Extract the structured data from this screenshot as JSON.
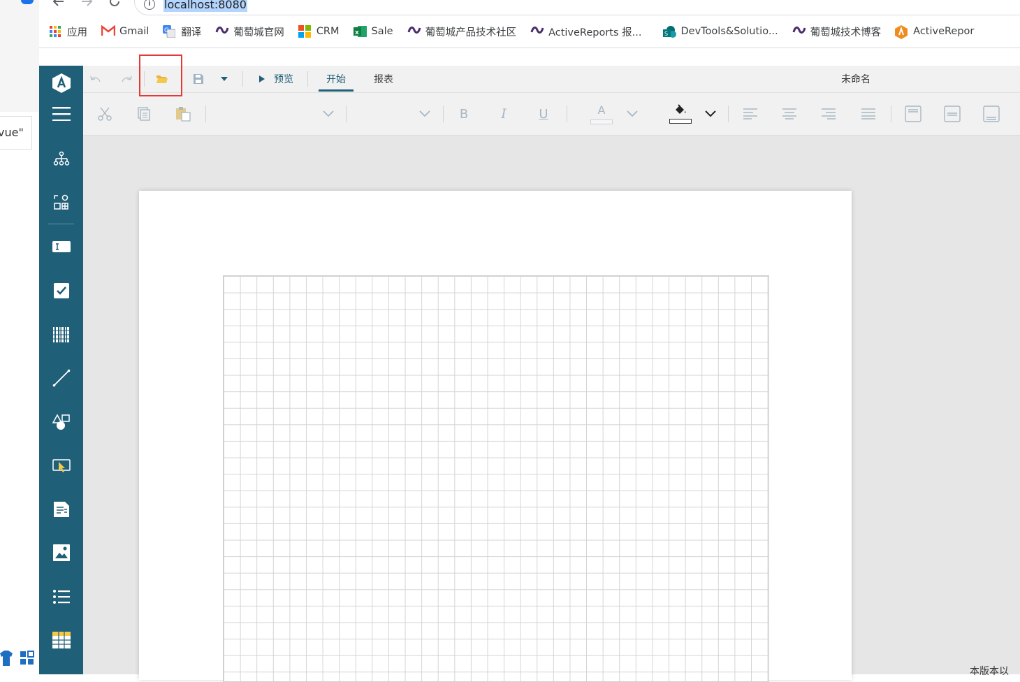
{
  "browser": {
    "address": "localhost:8080",
    "bookmarks": [
      {
        "label": "应用",
        "icon": "apps-grid-icon"
      },
      {
        "label": "Gmail",
        "icon": "gmail-icon"
      },
      {
        "label": "翻译",
        "icon": "translate-icon"
      },
      {
        "label": "葡萄城官网",
        "icon": "grapecity-icon"
      },
      {
        "label": "CRM",
        "icon": "microsoft-icon"
      },
      {
        "label": "Sale",
        "icon": "excel-icon"
      },
      {
        "label": "葡萄城产品技术社区",
        "icon": "grapecity-icon"
      },
      {
        "label": "ActiveReports 报...",
        "icon": "grapecity-icon"
      },
      {
        "label": "DevTools&Solutio...",
        "icon": "sharepoint-icon"
      },
      {
        "label": "葡萄城技术博客",
        "icon": "grapecity-icon"
      },
      {
        "label": "ActiveRepor",
        "icon": "activereports-icon"
      }
    ]
  },
  "left_window": {
    "tab_text": "vue\""
  },
  "designer": {
    "toolbar": {
      "preview_label": "预览",
      "tabs": [
        "开始",
        "报表"
      ],
      "active_tab": "开始",
      "document_title": "未命名"
    },
    "format_toolbar": {
      "bold": "B",
      "italic": "I",
      "underline": "U",
      "font_color": "A"
    },
    "footer_text": "本版本以"
  },
  "colors": {
    "sidebar": "#205f78",
    "highlight": "#e53935",
    "active_tab_underline": "#205f78",
    "folder_icon": "#f2c94c"
  }
}
